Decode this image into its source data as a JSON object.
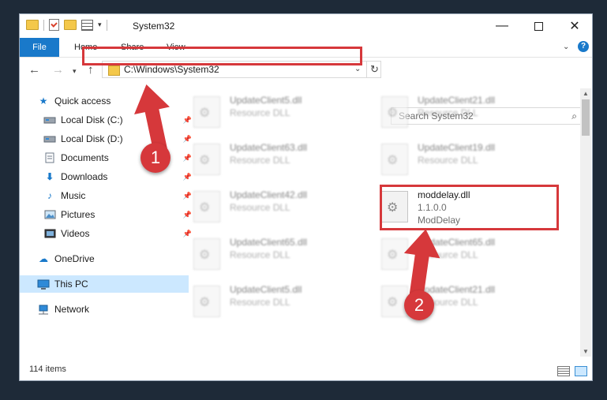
{
  "window": {
    "title": "System32",
    "controls": {
      "minimize": "—",
      "maximize": "",
      "close": "✕"
    }
  },
  "ribbon": {
    "tabs": [
      "File",
      "Home",
      "Share",
      "View"
    ],
    "help": "?"
  },
  "address_bar": {
    "path": "C:\\Windows\\System32"
  },
  "search": {
    "placeholder": "Search System32"
  },
  "sidebar": {
    "items": [
      {
        "label": "Quick access",
        "icon": "star-icon",
        "pinned": false
      },
      {
        "label": "Local Disk (C:)",
        "icon": "drive-icon",
        "pinned": true
      },
      {
        "label": "Local Disk (D:)",
        "icon": "drive-icon",
        "pinned": true
      },
      {
        "label": "Documents",
        "icon": "documents-icon",
        "pinned": true
      },
      {
        "label": "Downloads",
        "icon": "download-icon",
        "pinned": true
      },
      {
        "label": "Music",
        "icon": "music-icon",
        "pinned": true
      },
      {
        "label": "Pictures",
        "icon": "pictures-icon",
        "pinned": true
      },
      {
        "label": "Videos",
        "icon": "videos-icon",
        "pinned": true
      },
      {
        "label": "OneDrive",
        "icon": "cloud-icon",
        "pinned": false
      },
      {
        "label": "This PC",
        "icon": "computer-icon",
        "pinned": false,
        "selected": true
      },
      {
        "label": "Network",
        "icon": "network-icon",
        "pinned": false
      }
    ]
  },
  "files": [
    {
      "name": "UpdateClient5.dll",
      "type": "Resource DLL",
      "blurred": true
    },
    {
      "name": "UpdateClient21.dll",
      "type": "Resource DLL",
      "blurred": true
    },
    {
      "name": "UpdateClient63.dll",
      "type": "Resource DLL",
      "blurred": true
    },
    {
      "name": "UpdateClient19.dll",
      "type": "Resource DLL",
      "blurred": true
    },
    {
      "name": "UpdateClient42.dll",
      "type": "Resource DLL",
      "blurred": true
    },
    {
      "name": "moddelay.dll",
      "type": "1.1.0.0",
      "desc": "ModDelay",
      "blurred": false
    },
    {
      "name": "UpdateClient65.dll",
      "type": "Resource DLL",
      "blurred": true
    },
    {
      "name": "UpdateClient65.dll",
      "type": "Resource DLL",
      "blurred": true
    },
    {
      "name": "UpdateClient5.dll",
      "type": "Resource DLL",
      "blurred": true
    },
    {
      "name": "UpdateClient21.dll",
      "type": "Resource DLL",
      "blurred": true
    }
  ],
  "status": {
    "item_count": "114 items"
  },
  "annotations": {
    "step1": "1",
    "step2": "2",
    "color": "#d6383b"
  }
}
